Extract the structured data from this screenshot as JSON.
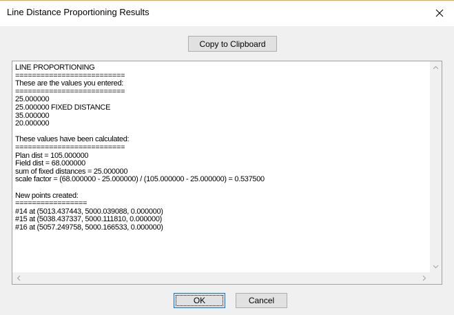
{
  "window": {
    "title": "Line Distance Proportioning Results"
  },
  "toolbar": {
    "copy_label": "Copy to Clipboard"
  },
  "output": {
    "lines": [
      "LINE PROPORTIONING",
      "==========================",
      "These are the values you entered:",
      "==========================",
      "25.000000",
      "25.000000 FIXED DISTANCE",
      "35.000000",
      "20.000000",
      "",
      "These values have been calculated:",
      "==========================",
      "Plan dist = 105.000000",
      "Field dist = 68.000000",
      "sum of fixed distances = 25.000000",
      "scale factor = (68.000000 - 25.000000) / (105.000000 - 25.000000) = 0.537500",
      "",
      "New points created:",
      "=================",
      "#14 at (5013.437443, 5000.039088, 0.000000)",
      "#15 at (5038.437337, 5000.111810, 0.000000)",
      "#16 at (5057.249758, 5000.166533, 0.000000)"
    ]
  },
  "footer": {
    "ok_label": "OK",
    "cancel_label": "Cancel"
  },
  "icons": {
    "close": "close-icon",
    "scroll_up": "chevron-up-icon",
    "scroll_down": "chevron-down-icon",
    "scroll_left": "chevron-left-icon",
    "scroll_right": "chevron-right-icon"
  }
}
